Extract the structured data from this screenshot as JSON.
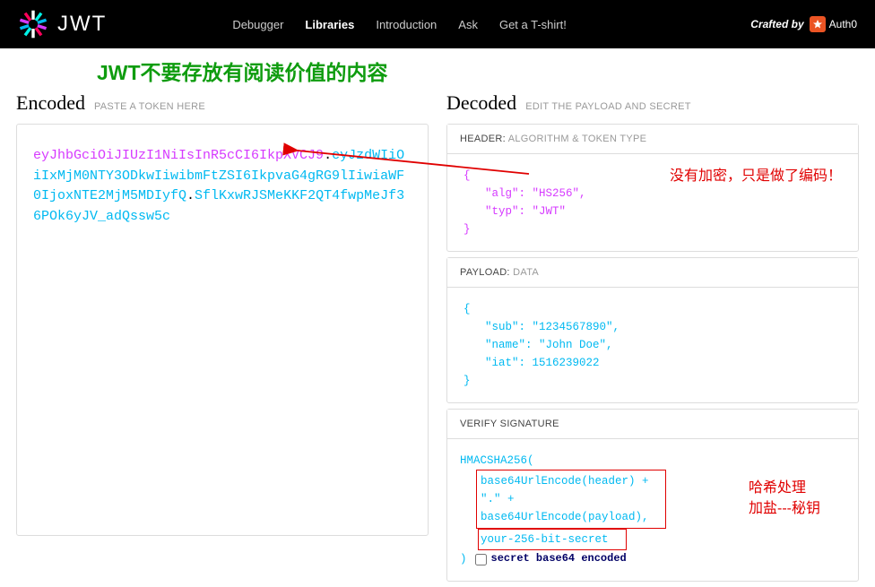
{
  "logo_text": "JWT",
  "nav": {
    "debugger": "Debugger",
    "libraries": "Libraries",
    "introduction": "Introduction",
    "ask": "Ask",
    "tshirt": "Get a T-shirt!"
  },
  "crafted_by": "Crafted by",
  "auth0": "Auth0",
  "annotation_main": "JWT不要存放有阅读价值的内容",
  "encoded": {
    "title": "Encoded",
    "sub": "PASTE A TOKEN HERE",
    "header": "eyJhbGciOiJIUzI1NiIsInR5cCI6IkpXVCJ9",
    "payload": "eyJzdWIiOiIxMjM0NTY3ODkwIiwibmFtZSI6IkpvaG4gRG9lIiwiaWF0IjoxNTE2MjM5MDIyfQ",
    "signature": "SflKxwRJSMeKKF2QT4fwpMeJf36POk6yJV_adQssw5c"
  },
  "decoded": {
    "title": "Decoded",
    "sub": "EDIT THE PAYLOAD AND SECRET",
    "header_label": "HEADER:",
    "header_sub": " ALGORITHM & TOKEN TYPE",
    "header_json": {
      "alg_key": "\"alg\"",
      "alg_val": "\"HS256\"",
      "typ_key": "\"typ\"",
      "typ_val": "\"JWT\""
    },
    "annotation_header": "没有加密，只是做了编码！",
    "payload_label": "PAYLOAD:",
    "payload_sub": " DATA",
    "payload_json": {
      "sub_key": "\"sub\"",
      "sub_val": "\"1234567890\"",
      "name_key": "\"name\"",
      "name_val": "\"John Doe\"",
      "iat_key": "\"iat\"",
      "iat_val": "1516239022"
    },
    "sig_label": "VERIFY SIGNATURE",
    "sig": {
      "fn": "HMACSHA256(",
      "l1": "base64UrlEncode(header) + \".\" +",
      "l2": "base64UrlEncode(payload),",
      "secret": "your-256-bit-secret",
      "close": ")",
      "check_label": "secret base64 encoded"
    },
    "annotation_hash": "哈希处理",
    "annotation_salt": "加盐---秘钥"
  }
}
